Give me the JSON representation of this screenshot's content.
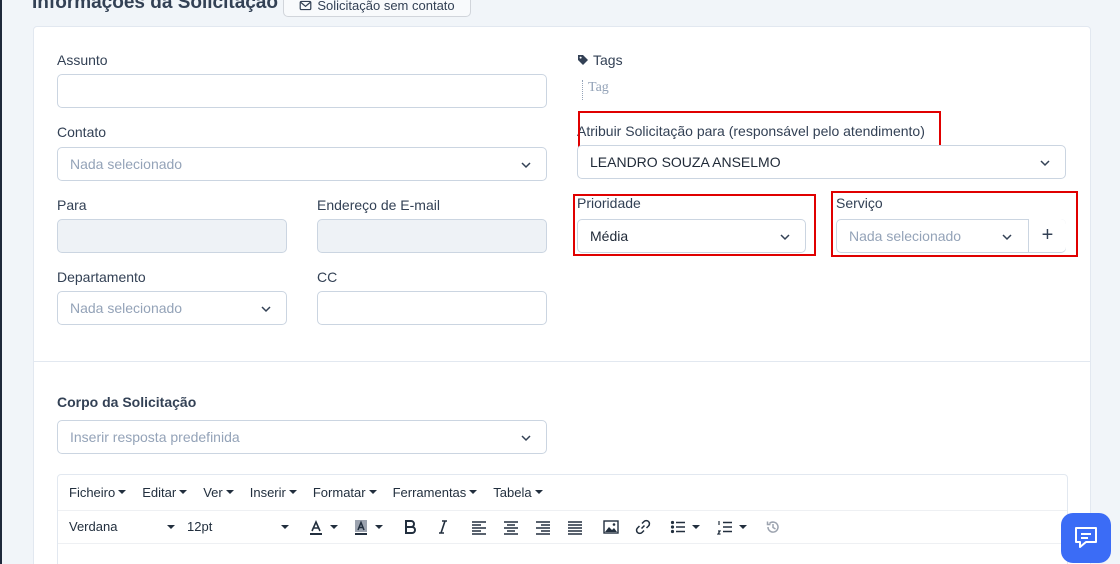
{
  "header": {
    "title": "Informações da Solicitação",
    "no_contact_button": "Solicitação sem contato"
  },
  "form": {
    "subject_label": "Assunto",
    "contact_label": "Contato",
    "contact_placeholder": "Nada selecionado",
    "to_label": "Para",
    "email_label": "Endereço de E-mail",
    "department_label": "Departamento",
    "department_placeholder": "Nada selecionado",
    "cc_label": "CC",
    "tags_label": "Tags",
    "tag_placeholder": "Tag",
    "assign_label": "Atribuir Solicitação para (responsável pelo atendimento)",
    "assign_value": "LEANDRO SOUZA ANSELMO",
    "priority_label": "Prioridade",
    "priority_value": "Média",
    "service_label": "Serviço",
    "service_placeholder": "Nada selecionado",
    "service_add": "+"
  },
  "body_section": {
    "label": "Corpo da Solicitação",
    "predefined_placeholder": "Inserir resposta predefinida"
  },
  "editor": {
    "menus": [
      "Ficheiro",
      "Editar",
      "Ver",
      "Inserir",
      "Formatar",
      "Ferramentas",
      "Tabela"
    ],
    "font_family": "Verdana",
    "font_size": "12pt"
  },
  "colors": {
    "accent": "#3b6cf6",
    "highlight": "#e00000"
  }
}
